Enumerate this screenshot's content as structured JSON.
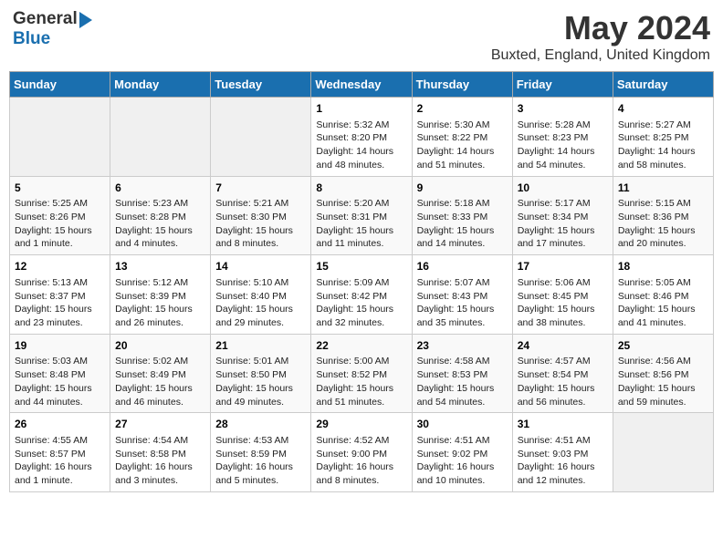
{
  "logo": {
    "general": "General",
    "blue": "Blue"
  },
  "title": "May 2024",
  "location": "Buxted, England, United Kingdom",
  "headers": [
    "Sunday",
    "Monday",
    "Tuesday",
    "Wednesday",
    "Thursday",
    "Friday",
    "Saturday"
  ],
  "weeks": [
    [
      {
        "day": "",
        "info": ""
      },
      {
        "day": "",
        "info": ""
      },
      {
        "day": "",
        "info": ""
      },
      {
        "day": "1",
        "info": "Sunrise: 5:32 AM\nSunset: 8:20 PM\nDaylight: 14 hours\nand 48 minutes."
      },
      {
        "day": "2",
        "info": "Sunrise: 5:30 AM\nSunset: 8:22 PM\nDaylight: 14 hours\nand 51 minutes."
      },
      {
        "day": "3",
        "info": "Sunrise: 5:28 AM\nSunset: 8:23 PM\nDaylight: 14 hours\nand 54 minutes."
      },
      {
        "day": "4",
        "info": "Sunrise: 5:27 AM\nSunset: 8:25 PM\nDaylight: 14 hours\nand 58 minutes."
      }
    ],
    [
      {
        "day": "5",
        "info": "Sunrise: 5:25 AM\nSunset: 8:26 PM\nDaylight: 15 hours\nand 1 minute."
      },
      {
        "day": "6",
        "info": "Sunrise: 5:23 AM\nSunset: 8:28 PM\nDaylight: 15 hours\nand 4 minutes."
      },
      {
        "day": "7",
        "info": "Sunrise: 5:21 AM\nSunset: 8:30 PM\nDaylight: 15 hours\nand 8 minutes."
      },
      {
        "day": "8",
        "info": "Sunrise: 5:20 AM\nSunset: 8:31 PM\nDaylight: 15 hours\nand 11 minutes."
      },
      {
        "day": "9",
        "info": "Sunrise: 5:18 AM\nSunset: 8:33 PM\nDaylight: 15 hours\nand 14 minutes."
      },
      {
        "day": "10",
        "info": "Sunrise: 5:17 AM\nSunset: 8:34 PM\nDaylight: 15 hours\nand 17 minutes."
      },
      {
        "day": "11",
        "info": "Sunrise: 5:15 AM\nSunset: 8:36 PM\nDaylight: 15 hours\nand 20 minutes."
      }
    ],
    [
      {
        "day": "12",
        "info": "Sunrise: 5:13 AM\nSunset: 8:37 PM\nDaylight: 15 hours\nand 23 minutes."
      },
      {
        "day": "13",
        "info": "Sunrise: 5:12 AM\nSunset: 8:39 PM\nDaylight: 15 hours\nand 26 minutes."
      },
      {
        "day": "14",
        "info": "Sunrise: 5:10 AM\nSunset: 8:40 PM\nDaylight: 15 hours\nand 29 minutes."
      },
      {
        "day": "15",
        "info": "Sunrise: 5:09 AM\nSunset: 8:42 PM\nDaylight: 15 hours\nand 32 minutes."
      },
      {
        "day": "16",
        "info": "Sunrise: 5:07 AM\nSunset: 8:43 PM\nDaylight: 15 hours\nand 35 minutes."
      },
      {
        "day": "17",
        "info": "Sunrise: 5:06 AM\nSunset: 8:45 PM\nDaylight: 15 hours\nand 38 minutes."
      },
      {
        "day": "18",
        "info": "Sunrise: 5:05 AM\nSunset: 8:46 PM\nDaylight: 15 hours\nand 41 minutes."
      }
    ],
    [
      {
        "day": "19",
        "info": "Sunrise: 5:03 AM\nSunset: 8:48 PM\nDaylight: 15 hours\nand 44 minutes."
      },
      {
        "day": "20",
        "info": "Sunrise: 5:02 AM\nSunset: 8:49 PM\nDaylight: 15 hours\nand 46 minutes."
      },
      {
        "day": "21",
        "info": "Sunrise: 5:01 AM\nSunset: 8:50 PM\nDaylight: 15 hours\nand 49 minutes."
      },
      {
        "day": "22",
        "info": "Sunrise: 5:00 AM\nSunset: 8:52 PM\nDaylight: 15 hours\nand 51 minutes."
      },
      {
        "day": "23",
        "info": "Sunrise: 4:58 AM\nSunset: 8:53 PM\nDaylight: 15 hours\nand 54 minutes."
      },
      {
        "day": "24",
        "info": "Sunrise: 4:57 AM\nSunset: 8:54 PM\nDaylight: 15 hours\nand 56 minutes."
      },
      {
        "day": "25",
        "info": "Sunrise: 4:56 AM\nSunset: 8:56 PM\nDaylight: 15 hours\nand 59 minutes."
      }
    ],
    [
      {
        "day": "26",
        "info": "Sunrise: 4:55 AM\nSunset: 8:57 PM\nDaylight: 16 hours\nand 1 minute."
      },
      {
        "day": "27",
        "info": "Sunrise: 4:54 AM\nSunset: 8:58 PM\nDaylight: 16 hours\nand 3 minutes."
      },
      {
        "day": "28",
        "info": "Sunrise: 4:53 AM\nSunset: 8:59 PM\nDaylight: 16 hours\nand 5 minutes."
      },
      {
        "day": "29",
        "info": "Sunrise: 4:52 AM\nSunset: 9:00 PM\nDaylight: 16 hours\nand 8 minutes."
      },
      {
        "day": "30",
        "info": "Sunrise: 4:51 AM\nSunset: 9:02 PM\nDaylight: 16 hours\nand 10 minutes."
      },
      {
        "day": "31",
        "info": "Sunrise: 4:51 AM\nSunset: 9:03 PM\nDaylight: 16 hours\nand 12 minutes."
      },
      {
        "day": "",
        "info": ""
      }
    ]
  ]
}
